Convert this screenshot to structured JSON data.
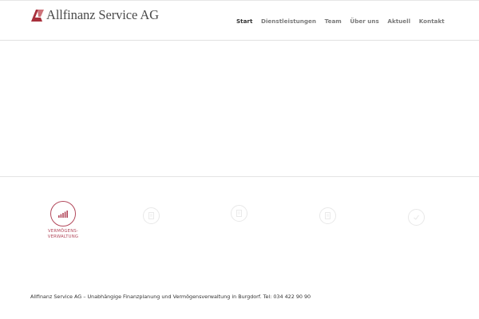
{
  "brand": {
    "name": "Allfinanz Service AG",
    "color": "#a8303c"
  },
  "nav": {
    "items": [
      {
        "label": "Start",
        "active": true
      },
      {
        "label": "Dienstleistungen",
        "active": false
      },
      {
        "label": "Team",
        "active": false
      },
      {
        "label": "Über uns",
        "active": false
      },
      {
        "label": "Aktuell",
        "active": false
      },
      {
        "label": "Kontakt",
        "active": false
      }
    ]
  },
  "services": [
    {
      "label_line1": "VERMÖGENS-",
      "label_line2": "VERWALTUNG",
      "icon": "bar-chart-icon",
      "active": true
    },
    {
      "label_line1": "",
      "label_line2": "",
      "icon": "document-icon",
      "active": false
    },
    {
      "label_line1": "",
      "label_line2": "",
      "icon": "document-icon",
      "active": false
    },
    {
      "label_line1": "",
      "label_line2": "",
      "icon": "document-icon",
      "active": false
    },
    {
      "label_line1": "",
      "label_line2": "",
      "icon": "check-icon",
      "active": false
    }
  ],
  "footer": {
    "text": "Allfinanz Service AG – Unabhängige Finanzplanung und Vermögensverwaltung in Burgdorf. Tel: 034 422 90 90"
  }
}
